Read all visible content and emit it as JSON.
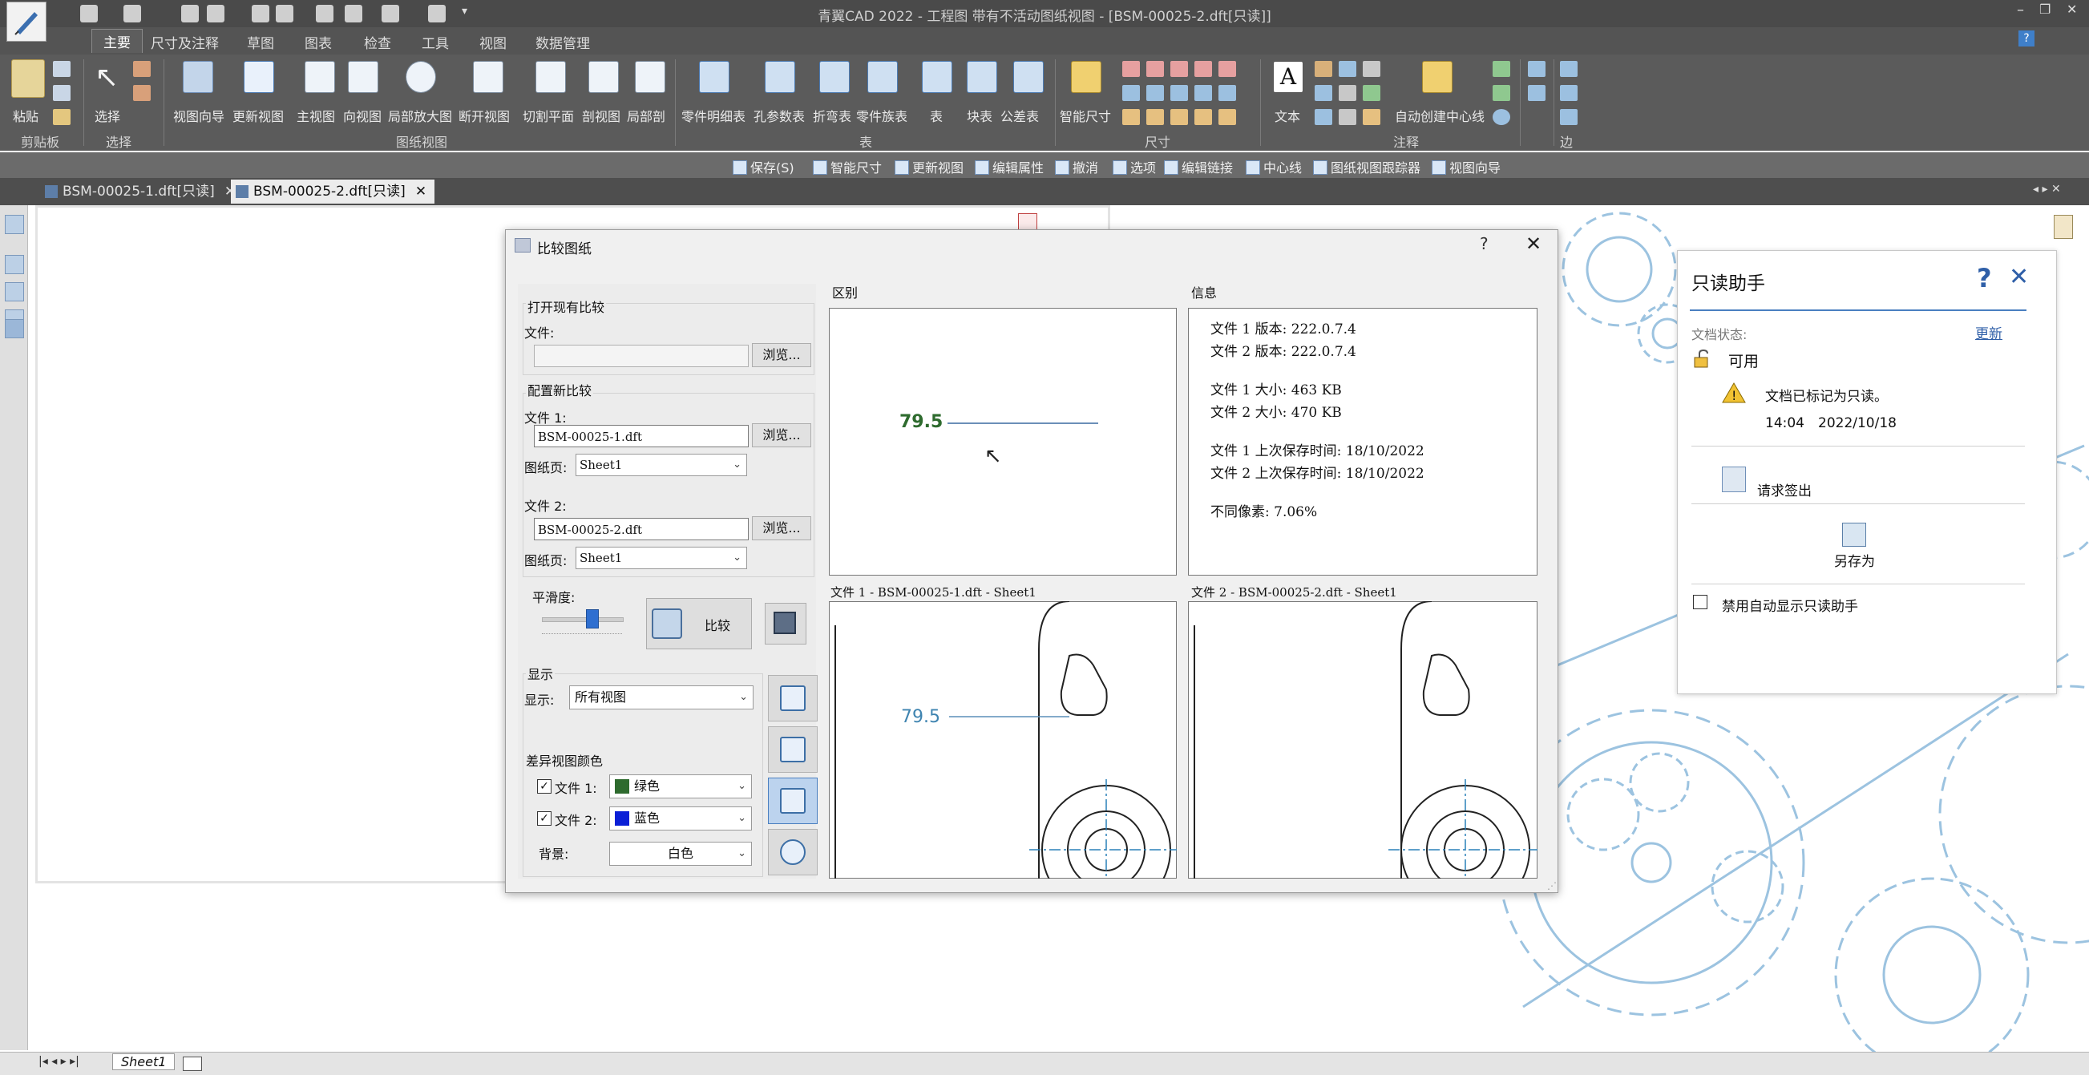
{
  "app": {
    "title": "青翼CAD 2022 - 工程图 带有不活动图纸视图 - [BSM-00025-2.dft[只读]]",
    "menu_tabs": [
      "主要",
      "尺寸及注释",
      "草图",
      "图表",
      "检查",
      "工具",
      "视图",
      "数据管理"
    ],
    "window_controls": {
      "minimize": "–",
      "restore": "❐",
      "close": "✕"
    },
    "help": "?"
  },
  "ribbon": {
    "clipboard": {
      "paste": "粘贴",
      "group": "剪贴板"
    },
    "select": {
      "select": "选择",
      "group": "选择"
    },
    "drawing_views": {
      "items": [
        "视图向导",
        "更新视图",
        "主视图",
        "向视图",
        "局部放大图",
        "断开视图",
        "切割平面",
        "剖视图",
        "局部剖"
      ],
      "group": "图纸视图"
    },
    "tables": {
      "items": [
        "零件明细表",
        "孔参数表",
        "折弯表",
        "零件族表",
        "表",
        "块表",
        "公差表"
      ],
      "group": "表"
    },
    "dimension": {
      "smart": "智能尺寸",
      "group": "尺寸"
    },
    "annotation": {
      "text": "文本",
      "centerline": "自动创建中心线",
      "group": "注释"
    },
    "edge": {
      "group": "边"
    }
  },
  "command_bar": [
    "保存(S)",
    "智能尺寸",
    "更新视图",
    "编辑属性",
    "撤消",
    "选项",
    "编辑链接",
    "中心线",
    "图纸视图跟踪器",
    "视图向导"
  ],
  "doc_tabs": [
    {
      "label": "BSM-00025-1.dft[只读]",
      "close": "✕"
    },
    {
      "label": "BSM-00025-2.dft[只读]",
      "close": "✕"
    }
  ],
  "sheet_tab": "Sheet1",
  "dialog": {
    "title": "比较图纸",
    "help": "?",
    "close": "✕",
    "open_existing": {
      "group": "打开现有比较",
      "file_label": "文件:",
      "file_value": "",
      "browse": "浏览..."
    },
    "new_compare": {
      "group": "配置新比较",
      "file1_label": "文件 1:",
      "file1_value": "BSM-00025-1.dft",
      "browse1": "浏览...",
      "sheet1_label": "图纸页:",
      "sheet1_value": "Sheet1",
      "file2_label": "文件 2:",
      "file2_value": "BSM-00025-2.dft",
      "browse2": "浏览...",
      "sheet2_label": "图纸页:",
      "sheet2_value": "Sheet1"
    },
    "smoothness": {
      "label": "平滑度:",
      "value": 0.62
    },
    "compare_button": "比较",
    "display": {
      "group": "显示",
      "label": "显示:",
      "value": "所有视图"
    },
    "diff_colors": {
      "group": "差异视图颜色",
      "file1_label": "文件 1:",
      "file1_color_name": "绿色",
      "file1_color": "#2e6b2e",
      "file2_label": "文件 2:",
      "file2_color_name": "蓝色",
      "file2_color": "#0a1fd6",
      "background_label": "背景:",
      "background_value": "白色"
    },
    "diff_panel": {
      "label": "区别",
      "dim_text": "79.5"
    },
    "info_panel": {
      "label": "信息",
      "lines": [
        "文件 1 版本: 222.0.7.4",
        "文件 2 版本: 222.0.7.4",
        "文件 1 大小: 463 KB",
        "文件 2 大小: 470 KB",
        "文件 1 上次保存时间: 18/10/2022",
        "文件 2 上次保存时间: 18/10/2022",
        "不同像素: 7.06%"
      ]
    },
    "file1_preview": {
      "label": "文件 1 - BSM-00025-1.dft - Sheet1",
      "dim_text": "79.5"
    },
    "file2_preview": {
      "label": "文件 2 - BSM-00025-2.dft - Sheet1"
    }
  },
  "readonly_assistant": {
    "title": "只读助手",
    "help": "?",
    "close": "✕",
    "status_label": "文档状态:",
    "refresh": "更新",
    "available": "可用",
    "warning": "文档已标记为只读。",
    "time": "14:04",
    "date": "2022/10/18",
    "request_checkout": "请求签出",
    "save_as": "另存为",
    "disable_auto": "禁用自动显示只读助手"
  },
  "colors": {
    "accent": "#2f5fa8",
    "ribbon": "#5b5b5b",
    "gear": "#8fb8d8"
  }
}
